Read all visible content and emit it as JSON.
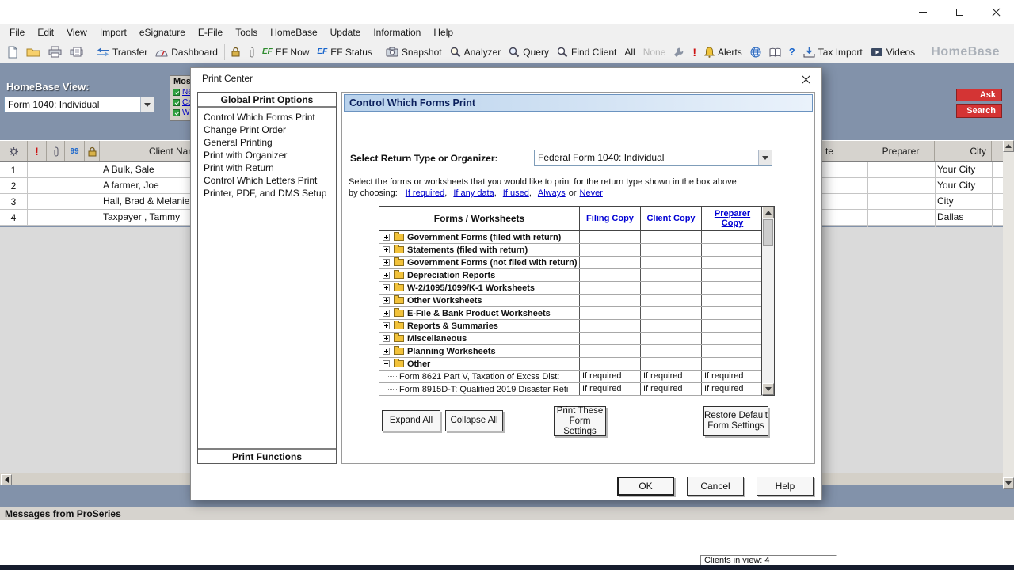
{
  "menubar": {
    "items": [
      "File",
      "Edit",
      "View",
      "Import",
      "eSignature",
      "E-File",
      "Tools",
      "HomeBase",
      "Update",
      "Information",
      "Help"
    ]
  },
  "toolbar": {
    "transfer": "Transfer",
    "dashboard": "Dashboard",
    "ef_glyph": "EF",
    "ef_now": "EF Now",
    "ef_status": "EF Status",
    "snapshot": "Snapshot",
    "analyzer": "Analyzer",
    "query": "Query",
    "find_client": "Find Client",
    "all": "All",
    "none": "None",
    "bang": "!",
    "alerts": "Alerts",
    "question": "?",
    "tax_import": "Tax Import",
    "videos": "Videos",
    "brand": "HomeBase"
  },
  "homebase": {
    "view_label": "HomeBase View:",
    "view_value": "Form 1040: Individual",
    "ask": "Ask",
    "search": "Search",
    "most": {
      "title": "Most",
      "items": [
        "Ne",
        "Ca",
        "Wh"
      ]
    },
    "grid": {
      "badge_99": "99",
      "col_client": "Client Name",
      "col_partial": "te",
      "col_preparer": "Preparer",
      "col_city": "City",
      "rows": [
        {
          "num": "1",
          "name": "A Bulk, Sale",
          "city": "Your City"
        },
        {
          "num": "2",
          "name": "A farmer, Joe",
          "city": "Your City"
        },
        {
          "num": "3",
          "name": "Hall, Brad & Melanie",
          "city": "City"
        },
        {
          "num": "4",
          "name": "Taxpayer , Tammy",
          "city": "Dallas"
        }
      ]
    }
  },
  "dialog": {
    "title": "Print Center",
    "nav": {
      "header": "Global Print Options",
      "items": [
        "Control Which Forms Print",
        "Change Print Order",
        "General Printing",
        "Print with Organizer",
        "Print with Return",
        "Control Which Letters Print",
        "Printer, PDF, and DMS Setup"
      ],
      "footer": "Print Functions"
    },
    "content": {
      "header": "Control Which Forms Print",
      "return_label": "Select Return Type or Organizer:",
      "return_value": "Federal Form 1040: Individual",
      "instruction_line1": "Select the forms or worksheets that you would like to print for the return type shown in the box above",
      "instruction_prefix": "by choosing:",
      "comma": ",",
      "or_word": "or",
      "links": {
        "if_required": "If required",
        "if_any_data": "If any data",
        "if_used": "If used",
        "always": "Always",
        "never": "Never"
      },
      "table": {
        "col_forms": "Forms / Worksheets",
        "col_filing": "Filing Copy",
        "col_client": "Client Copy",
        "col_preparer": "Preparer Copy",
        "folders": [
          "Government Forms (filed with return)",
          "Statements (filed with return)",
          "Government Forms (not filed with return)",
          "Depreciation Reports",
          "W-2/1095/1099/K-1 Worksheets",
          "Other Worksheets",
          "E-File & Bank Product Worksheets",
          "Reports & Summaries",
          "Miscellaneous",
          "Planning Worksheets",
          "Other"
        ],
        "items": [
          {
            "name": "Form 8621 Part V, Taxation of Excss Dist:",
            "filing": "If required",
            "client": "If required",
            "preparer": "If required"
          },
          {
            "name": "Form 8915D-T: Qualified 2019 Disaster Reti",
            "filing": "If required",
            "client": "If required",
            "preparer": "If required"
          }
        ]
      },
      "buttons": {
        "expand_all": "Expand All",
        "collapse_all": "Collapse All",
        "print_these_line1": "Print These",
        "print_these_line2": "Form Settings",
        "restore_line1": "Restore Default",
        "restore_line2": "Form Settings"
      }
    },
    "footer": {
      "ok": "OK",
      "cancel": "Cancel",
      "help": "Help"
    }
  },
  "status": {
    "messages": "Messages from ProSeries",
    "clients_in_view": "Clients in view: 4"
  }
}
